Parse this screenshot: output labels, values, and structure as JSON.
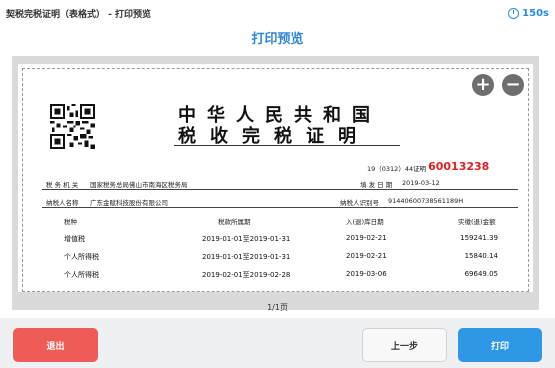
{
  "window": {
    "title": "契税完税证明（表格式） - 打印预览",
    "timer": "150s"
  },
  "header": {
    "title": "打印预览"
  },
  "document": {
    "title_line1": "中华人民共和国",
    "title_line2": "税收完税证明",
    "code_prefix": "19（0312）44证明",
    "cert_number": "60013238",
    "tax_office_label": "税 务 机 关",
    "tax_office_value": "国家税务总局佛山市南海区税务局",
    "fill_date_label": "填 发 日 期",
    "fill_date_value": "2019-03-12",
    "taxpayer_name_label": "纳税人名称",
    "taxpayer_name_value": "广东金赋科技股份有限公司",
    "taxpayer_id_label": "纳税人识别号",
    "taxpayer_id_value": "91440600738561189H",
    "columns": [
      "税种",
      "税款所属期",
      "入(退)库日期",
      "实缴(退)金额"
    ],
    "rows": [
      {
        "tax": "增值税",
        "period": "2019-01-01至2019-01-31",
        "date": "2019-02-21",
        "amount": "159241.39"
      },
      {
        "tax": "个人所得税",
        "period": "2019-01-01至2019-01-31",
        "date": "2019-02-21",
        "amount": "15840.14"
      },
      {
        "tax": "个人所得税",
        "period": "2019-02-01至2019-02-28",
        "date": "2019-03-06",
        "amount": "69649.05"
      }
    ]
  },
  "pager": {
    "text": "1/1页"
  },
  "buttons": {
    "exit": "退出",
    "prev": "上一步",
    "print": "打印"
  },
  "colors": {
    "accent": "#2f86d6",
    "exit": "#ef5b55",
    "print": "#2e97e6",
    "cert_number": "#e02020"
  }
}
